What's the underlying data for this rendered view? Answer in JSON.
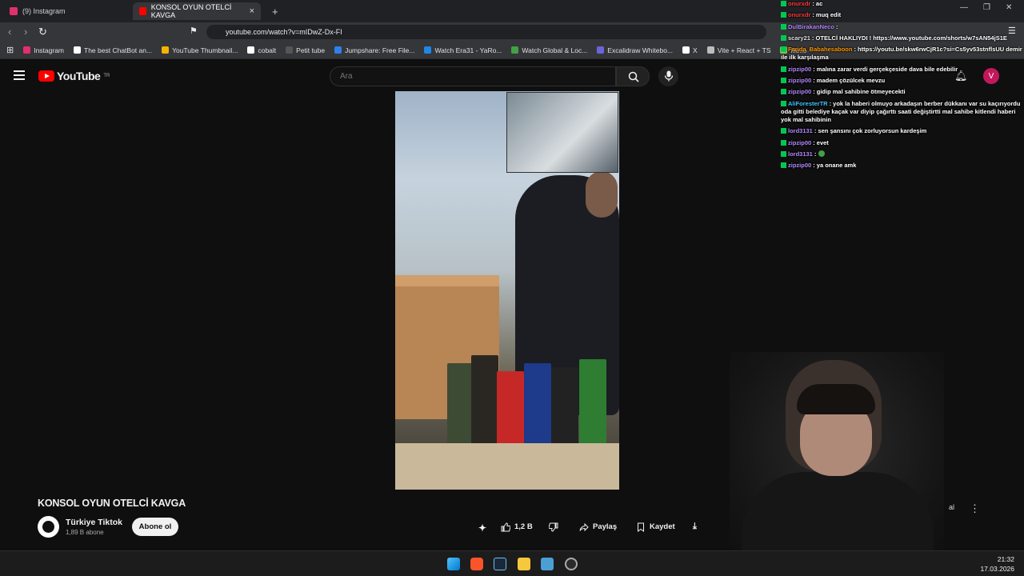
{
  "browser": {
    "tabs": [
      {
        "label": "(9) Instagram",
        "active": false
      },
      {
        "label": "KONSOL OYUN OTELCİ KAVGA",
        "active": true
      }
    ],
    "url": "youtube.com/watch?v=mIDwZ-Dx-FI",
    "bookmarks": [
      {
        "label": "Instagram",
        "icon": "instagram-icon",
        "color": "#e1306c"
      },
      {
        "label": "The best ChatBot an...",
        "icon": "chatbot-icon",
        "color": "#ffffff"
      },
      {
        "label": "YouTube Thumbnail...",
        "icon": "thumbnail-icon",
        "color": "#f4b400"
      },
      {
        "label": "cobalt",
        "icon": "cobalt-icon",
        "color": "#ffffff"
      },
      {
        "label": "Petit tube",
        "icon": "petittube-icon",
        "color": "#333333"
      },
      {
        "label": "Jumpshare: Free File...",
        "icon": "jumpshare-icon",
        "color": "#2f80ed"
      },
      {
        "label": "Watch Era31 - YaRo...",
        "icon": "era31-icon",
        "color": "#1e88e5"
      },
      {
        "label": "Watch Global & Loc...",
        "icon": "global-icon",
        "color": "#43a047"
      },
      {
        "label": "Excalidraw Whitebo...",
        "icon": "excalidraw-icon",
        "color": "#6965db"
      },
      {
        "label": "X",
        "icon": "x-icon",
        "color": "#ffffff"
      },
      {
        "label": "Vite + React + TS",
        "icon": "vite-icon",
        "color": "#bdbdbd"
      },
      {
        "label": "file.io",
        "icon": "fileio-icon",
        "color": "#8bc34a"
      }
    ]
  },
  "youtube": {
    "logo_text": "YouTube",
    "logo_region": "TR",
    "search_placeholder": "Ara",
    "avatar_letter": "V"
  },
  "video": {
    "title": "KONSOL OYUN OTELCİ KAVGA",
    "channel_name": "Türkiye Tiktok",
    "channel_subs": "1,89 B abone",
    "subscribe_label": "Abone ol",
    "like_count": "1,2 B",
    "share_label": "Paylaş",
    "save_label": "Kaydet",
    "partial_label": "al"
  },
  "chat": [
    {
      "user": "onurxdr",
      "text": ": ac",
      "color": "#ff3b3b"
    },
    {
      "user": "onurxdr",
      "text": ": muq edit",
      "color": "#ff3b3b"
    },
    {
      "user": "DulBirakanNeco",
      "text": ":",
      "color": "#b388ff"
    },
    {
      "user": "scary21",
      "text": ": OTELCİ HAKLIYDI ! https://www.youtube.com/shorts/w7sAN54jS1E",
      "color": "#e0e0e0"
    },
    {
      "user": "Farida_Babahesaboon",
      "text": ": https://youtu.be/skw6rwCjR1c?si=Cs5yv53stnflsUU demir ile ilk karşılaşma",
      "color": "#ff9800"
    },
    {
      "user": "zipzip00",
      "text": ": malına zarar verdi gerçekçeside dava bile edebilir",
      "color": "#b388ff"
    },
    {
      "user": "zipzip00",
      "text": ": madem çözülcek mevzu",
      "color": "#b388ff"
    },
    {
      "user": "zipzip00",
      "text": ": gidip mal sahibine ötmeyecekti",
      "color": "#b388ff"
    },
    {
      "user": "AliForesterTR",
      "text": ": yok la haberi olmuyo arkadaşın berber dükkanı var su kaçırıyordu oda gitti belediye kaçak var diyip çağırttı saati değiştirtti mal sahibe kitlendi haberi yok mal sahibinin",
      "color": "#40c4ff"
    },
    {
      "user": "lord3131",
      "text": ": sen şansını çok zorluyorsun kardeşim",
      "color": "#b388ff"
    },
    {
      "user": "zipzip00",
      "text": ": evet",
      "color": "#b388ff"
    },
    {
      "user": "lord3131",
      "text": ":",
      "color": "#b388ff"
    },
    {
      "user": "zipzip00",
      "text": ": ya onane amk",
      "color": "#b388ff"
    }
  ],
  "taskbar": {
    "time": "21:32",
    "date": "17.03.2026"
  }
}
